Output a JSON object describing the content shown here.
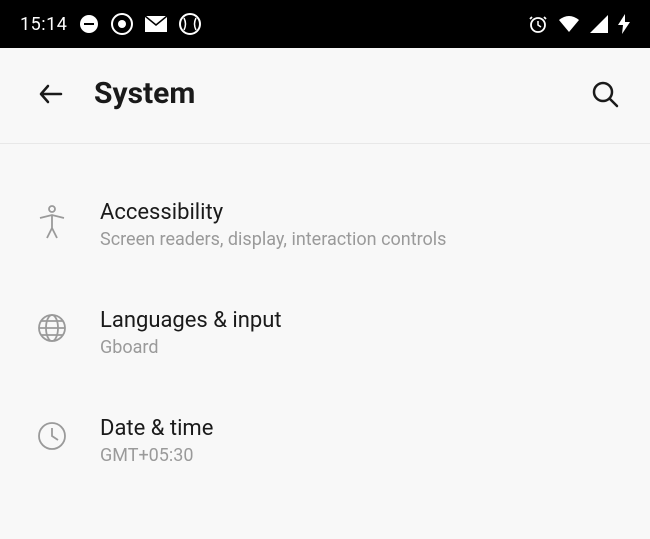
{
  "statusBar": {
    "time": "15:14"
  },
  "header": {
    "title": "System"
  },
  "settings": {
    "items": [
      {
        "title": "Accessibility",
        "subtitle": "Screen readers, display, interaction controls"
      },
      {
        "title": "Languages & input",
        "subtitle": "Gboard"
      },
      {
        "title": "Date & time",
        "subtitle": "GMT+05:30"
      }
    ]
  }
}
